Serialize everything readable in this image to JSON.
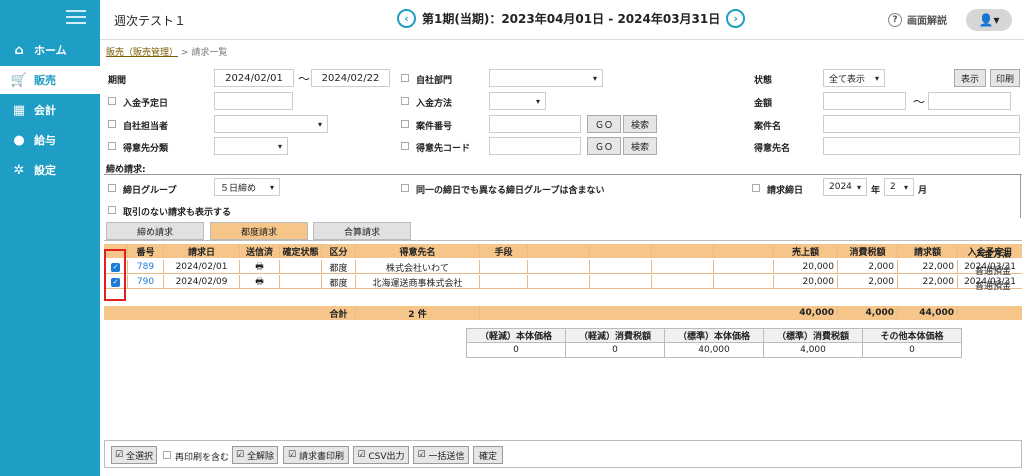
{
  "sidebar": {
    "items": [
      {
        "label": "ホーム",
        "icon": "home-icon"
      },
      {
        "label": "販売",
        "icon": "cart-icon"
      },
      {
        "label": "会計",
        "icon": "calculator-icon"
      },
      {
        "label": "給与",
        "icon": "money-bag-icon"
      },
      {
        "label": "設定",
        "icon": "gear-icon"
      }
    ]
  },
  "header": {
    "title": "週次テスト１",
    "period": "第1期(当期)：2023年04月01日 - 2024年03月31日",
    "help": "画面解説"
  },
  "breadcrumb": {
    "link": "販売（販売管理）",
    "sep": ">",
    "current": "請求一覧"
  },
  "form": {
    "period_label": "期間",
    "period_from": "2024/02/01",
    "tilde": "〜",
    "period_to": "2024/02/22",
    "company_dept_label": "自社部門",
    "status_label": "状態",
    "status_value": "全て表示",
    "show_button": "表示",
    "print_button": "印刷",
    "payment_date_label": "入金予定日",
    "payment_method_label": "入金方法",
    "amount_label": "金額",
    "staff_label": "自社担当者",
    "case_no_label": "案件番号",
    "go_label": "ＧＯ",
    "search_label": "検索",
    "case_name_label": "案件名",
    "client_category_label": "得意先分類",
    "client_code_label": "得意先コード",
    "client_name_label": "得意先名",
    "closing_header": "締め請求:",
    "closing_group_label": "締日グループ",
    "closing_group_value": "５日締め",
    "same_closing_label": "同一の締日でも異なる締日グループは含まない",
    "billing_date_label": "請求締日",
    "year_value": "2024",
    "year_unit": "年",
    "month_value": "2",
    "month_unit": "月",
    "show_no_transactions_label": "取引のない請求も表示する"
  },
  "tabs": [
    "締め請求",
    "都度請求",
    "合算請求"
  ],
  "table": {
    "headers": [
      "番号",
      "請求日",
      "送信済",
      "確定状態",
      "区分",
      "得意先名",
      "手段",
      "",
      "",
      "",
      "",
      "売上額",
      "消費税額",
      "請求額",
      "入金予定日",
      "入金方法"
    ],
    "rows": [
      {
        "no": "789",
        "date": "2024/02/01",
        "category": "都度",
        "client": "株式会社いわて",
        "sales": "20,000",
        "tax": "2,000",
        "billed": "22,000",
        "due": "2024/03/31",
        "method": "普通預金"
      },
      {
        "no": "790",
        "date": "2024/02/09",
        "category": "都度",
        "client": "北海運送商事株式会社",
        "sales": "20,000",
        "tax": "2,000",
        "billed": "22,000",
        "due": "2024/03/31",
        "method": "普通預金"
      }
    ],
    "total_label": "合計",
    "total_count": "2 件",
    "total_sales": "40,000",
    "total_tax": "4,000",
    "total_billed": "44,000"
  },
  "tax_summary": {
    "headers": [
      "（軽減）本体価格",
      "（軽減）消費税額",
      "（標準）本体価格",
      "（標準）消費税額",
      "その他本体価格"
    ],
    "values": [
      "0",
      "0",
      "40,000",
      "4,000",
      "0"
    ]
  },
  "footer": {
    "select_all": "全選択",
    "include_printed": "再印刷を含む",
    "deselect_all": "全解除",
    "print_invoice": "請求書印刷",
    "csv_output": "CSV出力",
    "bulk_send": "一括送信",
    "confirm": "確定"
  },
  "colors": {
    "accent": "#1e9ec4",
    "table_header": "#f5c58a",
    "highlight_box": "#e02020"
  }
}
